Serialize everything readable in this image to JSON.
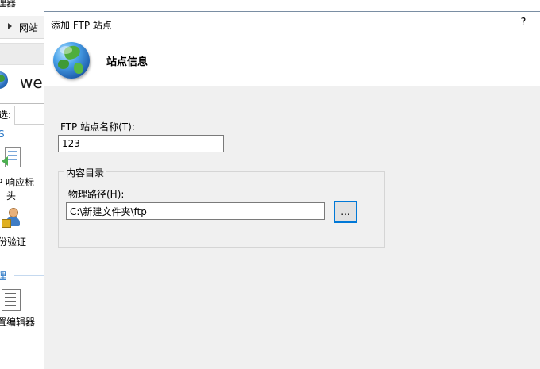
{
  "background_app": {
    "title_fragment": "理器",
    "nav_label": "网站",
    "site_name_fragment": "wel",
    "filter_label": "选:",
    "group_s_label": "S",
    "features": [
      {
        "label_line1": "P 响应标",
        "label_line2": "头"
      },
      {
        "label_line1": "份验证"
      }
    ],
    "group_manage_label": "理",
    "config_editor_label": "置编辑器"
  },
  "dialog": {
    "title": "添加 FTP 站点",
    "help_label": "?",
    "heading": "站点信息",
    "site_name_label": "FTP 站点名称(T):",
    "site_name_value": "123",
    "content_group_title": "内容目录",
    "physical_path_label": "物理路径(H):",
    "physical_path_value": "C:\\新建文件夹\\ftp",
    "browse_label": "..."
  },
  "colors": {
    "dialog_background": "#f0f0f0",
    "focus_border": "#0078d7",
    "link_blue": "#2b78c6"
  }
}
